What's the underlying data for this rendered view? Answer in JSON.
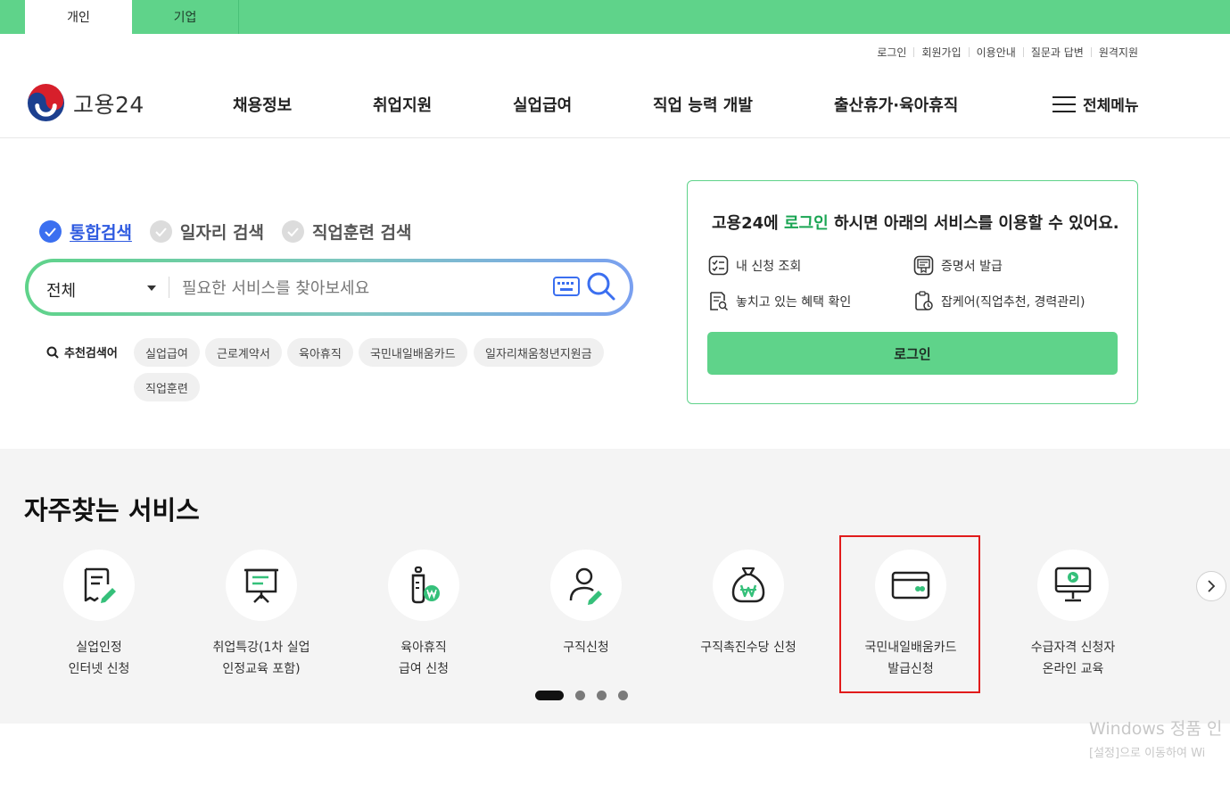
{
  "top_tabs": [
    {
      "label": "개인",
      "active": true
    },
    {
      "label": "기업",
      "active": false
    }
  ],
  "util_links": [
    "로그인",
    "회원가입",
    "이용안내",
    "질문과 답변",
    "원격지원"
  ],
  "logo": {
    "text": "고용24"
  },
  "gnb": [
    "채용정보",
    "취업지원",
    "실업급여",
    "직업 능력 개발",
    "출산휴가·육아휴직"
  ],
  "all_menu": {
    "label": "전체메뉴",
    "icon": "hamburger-icon"
  },
  "search": {
    "types": [
      {
        "label": "통합검색",
        "selected": true
      },
      {
        "label": "일자리 검색",
        "selected": false
      },
      {
        "label": "직업훈련 검색",
        "selected": false
      }
    ],
    "scope": "전체",
    "placeholder": "필요한 서비스를 찾아보세요",
    "value": "",
    "keyboard_icon": "keyboard-icon",
    "search_icon": "search-icon"
  },
  "recommend": {
    "label": "추천검색어",
    "keywords": [
      "실업급여",
      "근로계약서",
      "육아휴직",
      "국민내일배움카드",
      "일자리채움청년지원금",
      "직업훈련"
    ]
  },
  "login_box": {
    "title_pre": "고용24에 ",
    "title_hl": "로그인",
    "title_post": " 하시면 아래의 서비스를 이용할 수 있어요.",
    "items": [
      {
        "label": "내 신청 조회",
        "icon": "checklist-icon"
      },
      {
        "label": "증명서 발급",
        "icon": "certificate-icon"
      },
      {
        "label": "놓치고 있는 혜택 확인",
        "icon": "document-search-icon"
      },
      {
        "label": "잡케어(직업추천, 경력관리)",
        "icon": "clipboard-clock-icon"
      }
    ],
    "button": "로그인",
    "accent": "#5fd38a",
    "highlight_color": "#1aa553"
  },
  "services": {
    "title": "자주찾는 서비스",
    "items": [
      {
        "label": "실업인정\n인터넷 신청",
        "icon": "document-pen-icon"
      },
      {
        "label": "취업특강(1차 실업\n인정교육 포함)",
        "icon": "presentation-board-icon"
      },
      {
        "label": "육아휴직\n급여 신청",
        "icon": "baby-bottle-won-icon"
      },
      {
        "label": "구직신청",
        "icon": "person-pen-icon"
      },
      {
        "label": "구직촉진수당 신청",
        "icon": "money-bag-won-icon"
      },
      {
        "label": "국민내일배움카드\n발급신청",
        "icon": "card-icon",
        "highlighted": true
      },
      {
        "label": "수급자격 신청자\n온라인 교육",
        "icon": "monitor-play-icon"
      }
    ],
    "pagination": {
      "current": 1,
      "total": 4
    },
    "next_icon": "chevron-right-icon"
  },
  "watermark": {
    "line1": "Windows 정품 인",
    "line2": "[설정]으로 이동하여 Wi"
  },
  "colors": {
    "brand_green": "#5fd38a",
    "accent_blue": "#3b6ff0",
    "highlight_red": "#e11b1b"
  }
}
